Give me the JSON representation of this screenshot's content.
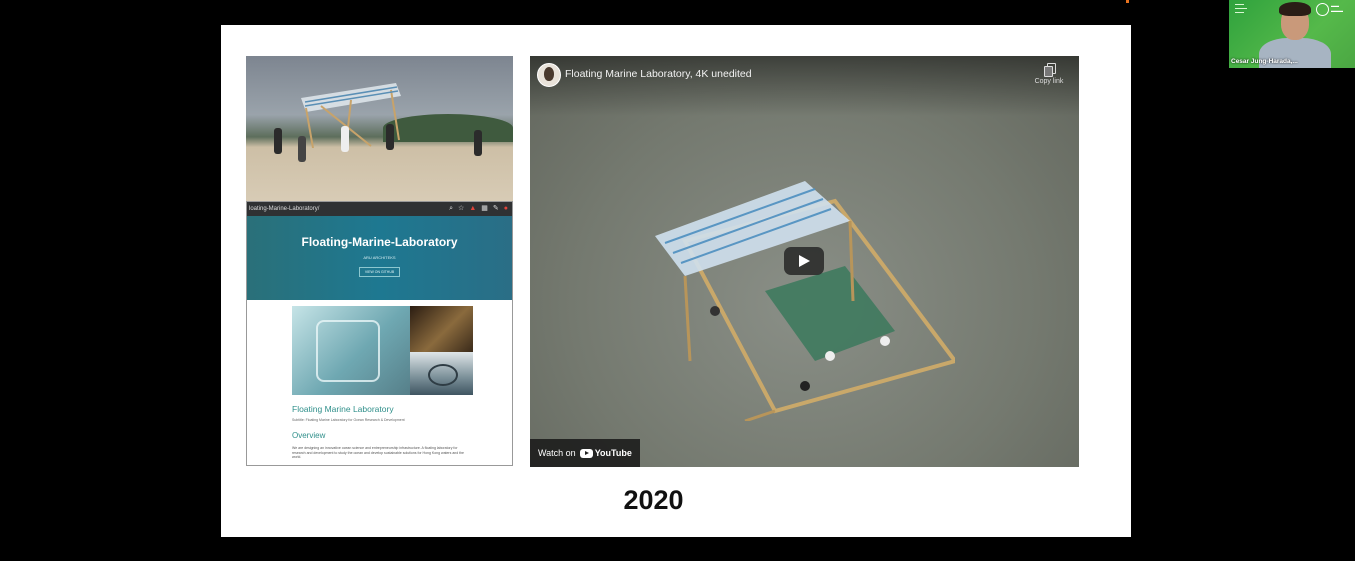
{
  "slide": {
    "year": "2020",
    "left_panel": {
      "browser_url": "loating-Marine-Laboratory/",
      "site_title": "Floating-Marine-Laboratory",
      "site_subtitle": "ARU ARCHITEKS",
      "site_button": "VIEW ON GITHUB",
      "page_title": "Floating Marine Laboratory",
      "page_subtitle": "Subtitle: Floating Marine Laboratory for Ocean Research & Development",
      "overview_heading": "Overview",
      "overview_body": "We are designing an innovative ocean science and entrepreneurship infrastructure. A floating laboratory for research and development to study the ocean and develop sustainable solutions for Hong Kong waters and the world."
    },
    "video": {
      "title": "Floating Marine Laboratory, 4K unedited",
      "copy_link_label": "Copy link",
      "watch_on_label": "Watch on",
      "platform_name": "YouTube"
    }
  },
  "webcam": {
    "participant_name": "Cesar Jung-Harada,..."
  },
  "colors": {
    "background": "#000000",
    "slide": "#ffffff",
    "accent_teal": "#2f8f8a",
    "webcam_green": "#4ba743"
  }
}
